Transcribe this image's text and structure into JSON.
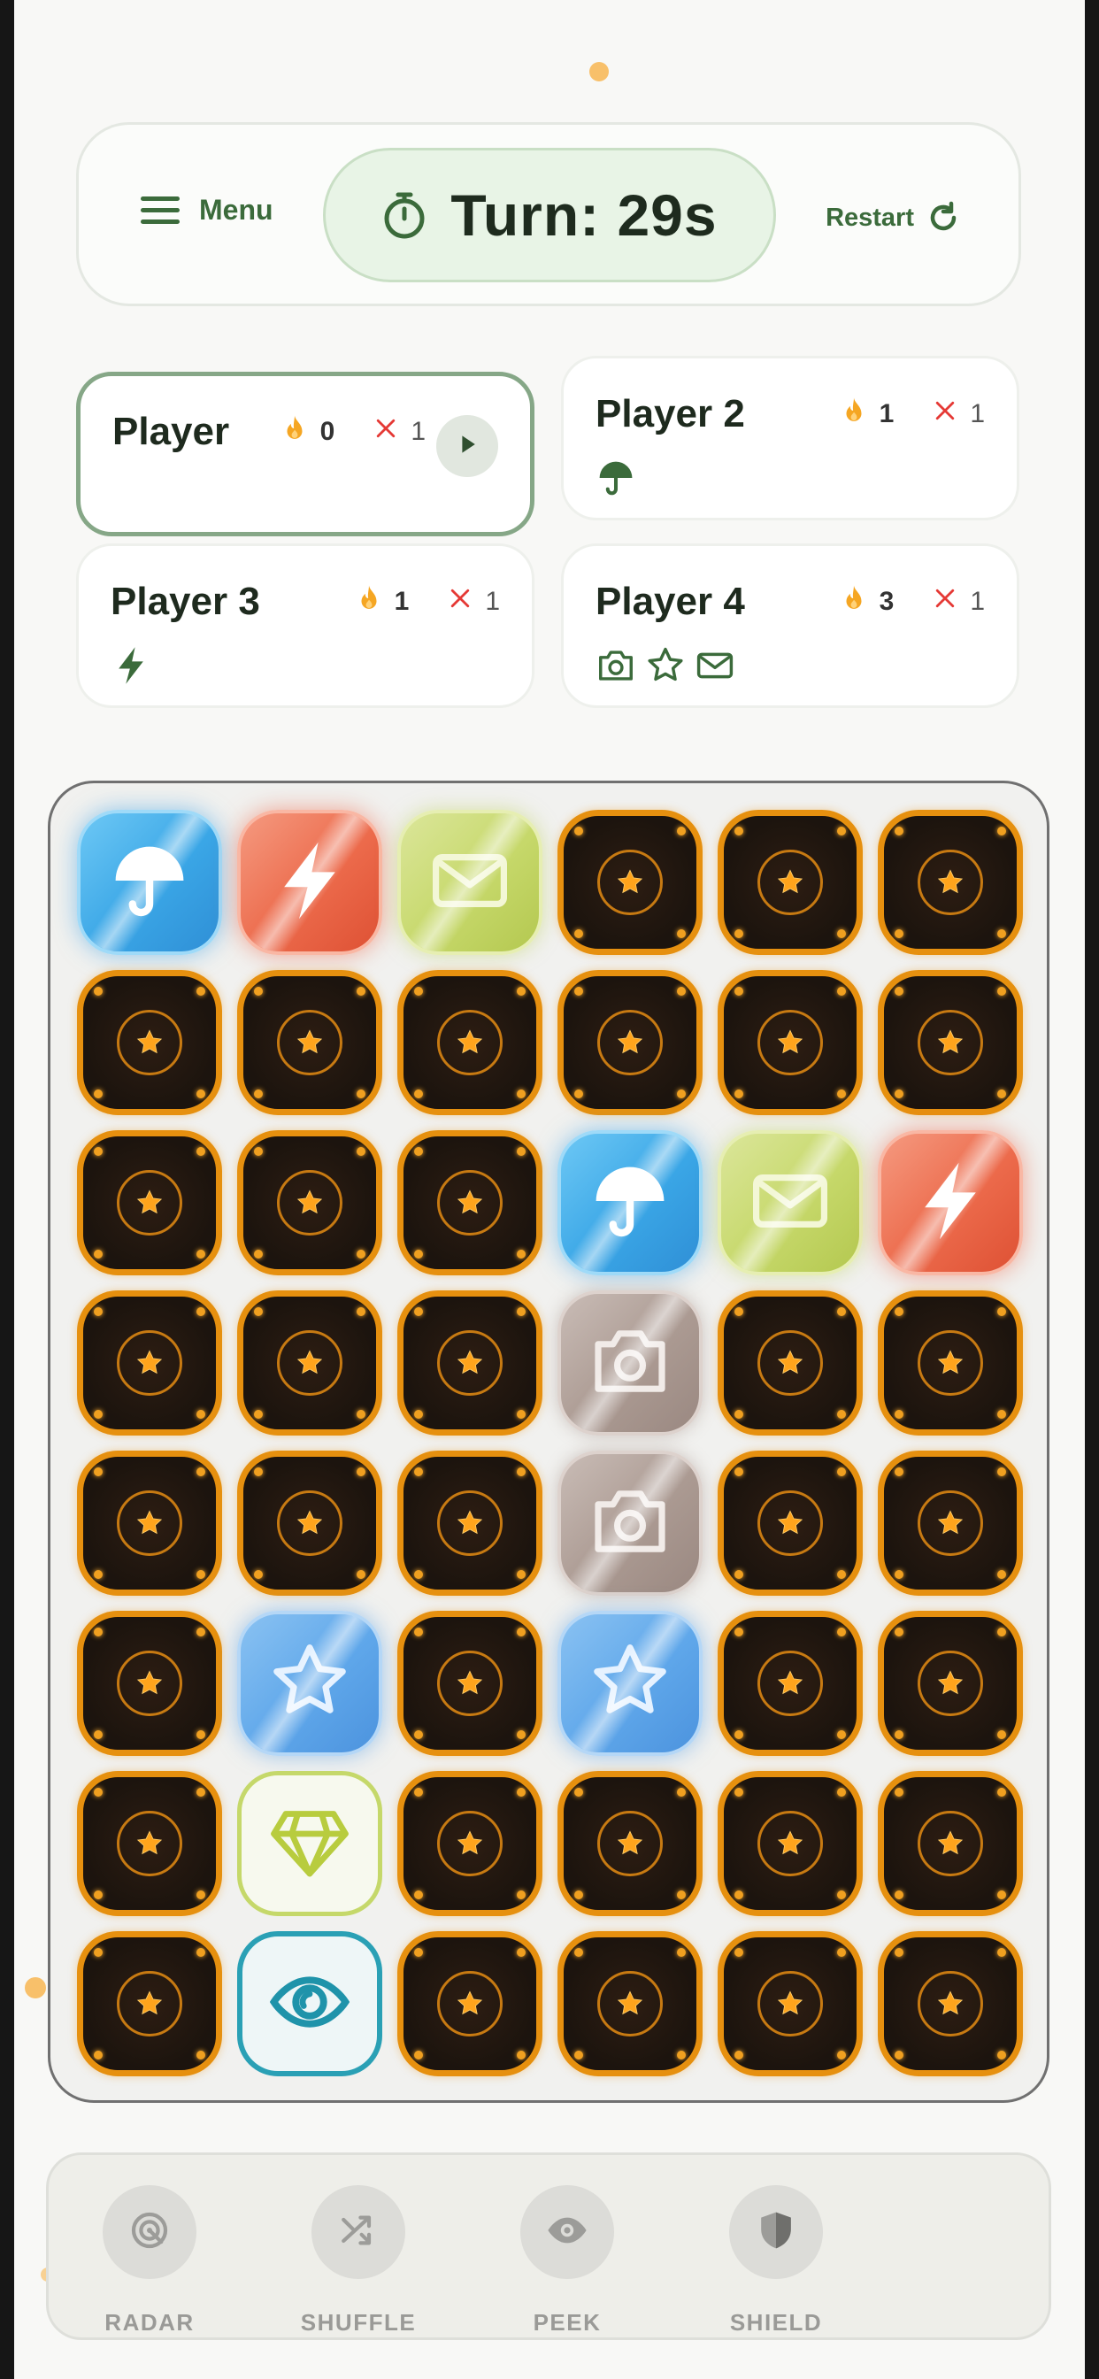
{
  "header": {
    "menu_label": "Menu",
    "turn_text": "Turn: 29s",
    "restart_label": "Restart"
  },
  "players": [
    {
      "name": "Player",
      "fire": "0",
      "misses": "1",
      "active": true,
      "icons": []
    },
    {
      "name": "Player 2",
      "fire": "1",
      "misses": "1",
      "active": false,
      "icons": [
        "umbrella-icon"
      ]
    },
    {
      "name": "Player 3",
      "fire": "1",
      "misses": "1",
      "active": false,
      "icons": [
        "lightning-icon"
      ]
    },
    {
      "name": "Player 4",
      "fire": "3",
      "misses": "1",
      "active": false,
      "icons": [
        "camera-icon",
        "star-outline-icon",
        "mail-icon"
      ]
    }
  ],
  "board": {
    "rows": 8,
    "cols": 6,
    "tiles": [
      [
        "blue-umbrella",
        "red-lightning",
        "lime-mail",
        "hidden",
        "hidden",
        "hidden"
      ],
      [
        "hidden",
        "hidden",
        "hidden",
        "hidden",
        "hidden",
        "hidden"
      ],
      [
        "hidden",
        "hidden",
        "hidden",
        "blue-umbrella",
        "lime-mail",
        "red-lightning"
      ],
      [
        "hidden",
        "hidden",
        "hidden",
        "taupe-camera",
        "hidden",
        "hidden"
      ],
      [
        "hidden",
        "hidden",
        "hidden",
        "taupe-camera",
        "hidden",
        "hidden"
      ],
      [
        "hidden",
        "sky-star",
        "hidden",
        "sky-star",
        "hidden",
        "hidden"
      ],
      [
        "hidden",
        "gem-diamond",
        "hidden",
        "hidden",
        "hidden",
        "hidden"
      ],
      [
        "hidden",
        "eye-peek",
        "hidden",
        "hidden",
        "hidden",
        "hidden"
      ]
    ]
  },
  "powerups": [
    {
      "label": "RADAR",
      "icon": "radar-icon"
    },
    {
      "label": "SHUFFLE",
      "icon": "shuffle-icon"
    },
    {
      "label": "PEEK",
      "icon": "eye-icon"
    },
    {
      "label": "SHIELD",
      "icon": "shield-icon"
    }
  ],
  "colors": {
    "accent_green": "#3b6b3b",
    "tile_border_orange": "#e6900f",
    "fire_orange": "#f5a623",
    "miss_red": "#e53935"
  }
}
